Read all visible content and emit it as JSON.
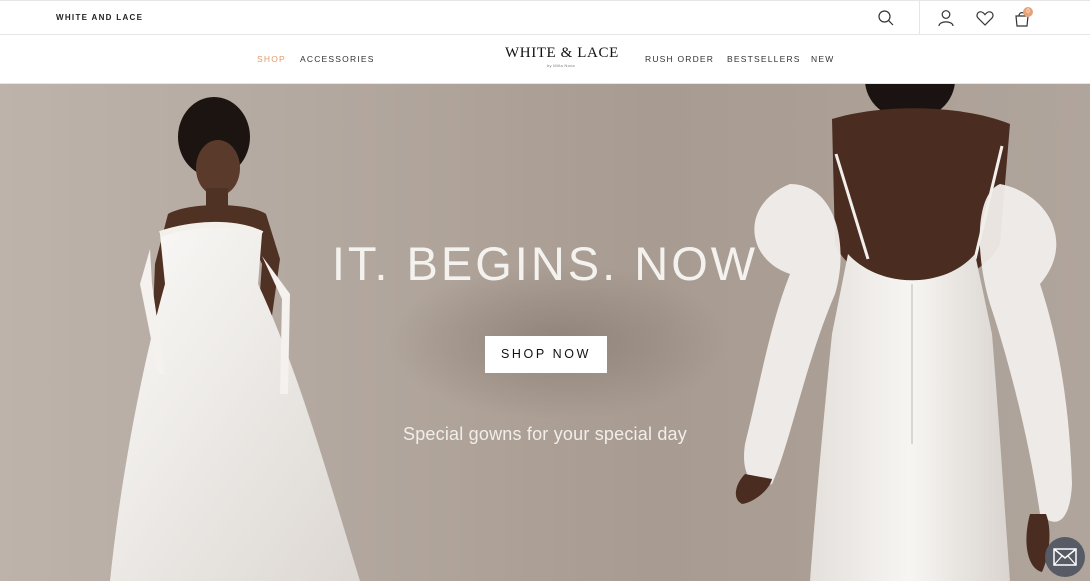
{
  "topbar": {
    "brand": "WHITE AND LACE",
    "icons": [
      "search-icon",
      "account-icon",
      "heart-icon",
      "bag-icon"
    ],
    "cart_count": "0"
  },
  "nav": {
    "links_left": [
      {
        "label": "SHOP",
        "active": true
      },
      {
        "label": "ACCESSORIES",
        "active": false
      }
    ],
    "logo": "WHITE & LACE",
    "logo_sub": "by Milla Nova",
    "links_right": [
      {
        "label": "RUSH ORDER"
      },
      {
        "label": "BESTSELLERS"
      },
      {
        "label": "NEW"
      }
    ]
  },
  "hero": {
    "title": "IT. BEGINS. NOW",
    "cta": "SHOP NOW",
    "subtitle": "Special gowns for your special day"
  },
  "floating": {
    "icon": "mail-icon"
  },
  "colors": {
    "accent": "#e39a6b",
    "hero_bg": "#b3a89f",
    "chat_button": "#565b66"
  }
}
